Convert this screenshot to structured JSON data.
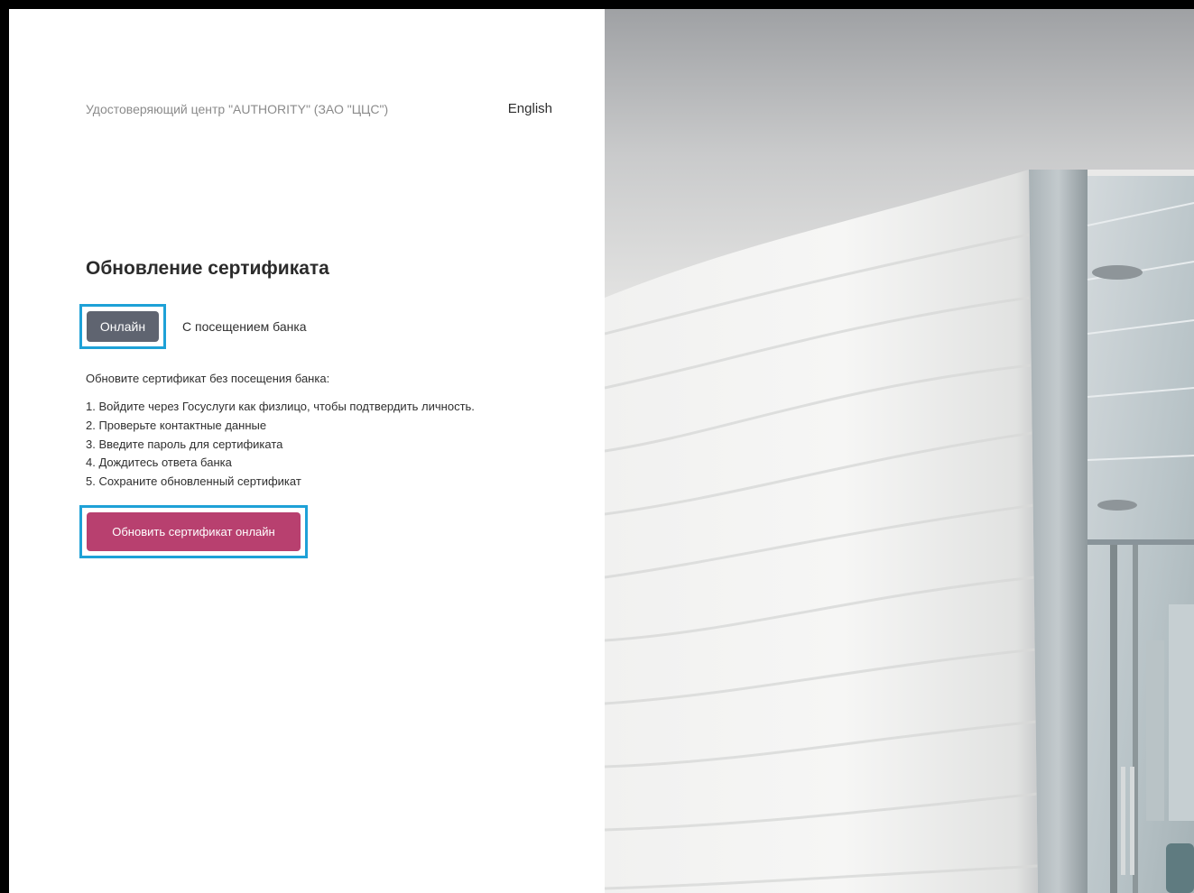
{
  "header": {
    "org_name": "Удостоверяющий центр \"AUTHORITY\" (ЗАО \"ЦЦС\")",
    "language_link": "English"
  },
  "main": {
    "title": "Обновление сертификата",
    "tabs": [
      {
        "label": "Онлайн",
        "selected": true
      },
      {
        "label": "С посещением банка",
        "selected": false
      }
    ],
    "intro": "Обновите сертификат без посещения банка:",
    "steps": [
      "1. Войдите через Госуслуги как физлицо, чтобы подтвердить личность.",
      "2. Проверьте контактные данные",
      "3. Введите пароль для сертификата",
      "4. Дождитесь ответа банка",
      "5. Сохраните обновленный сертификат"
    ],
    "cta_label": "Обновить сертификат онлайн"
  },
  "colors": {
    "accent_button": "#b8406f",
    "selected_tab": "#5f6470",
    "highlight_outline": "#1ea1d7"
  }
}
